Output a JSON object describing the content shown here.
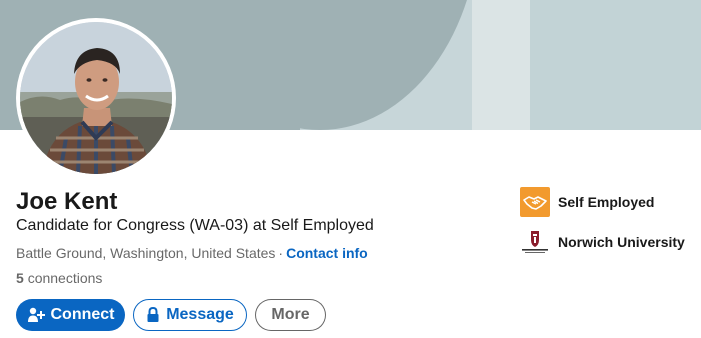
{
  "profile": {
    "name": "Joe Kent",
    "headline": "Candidate for Congress (WA-03) at Self Employed",
    "location": "Battle Ground, Washington, United States",
    "separator": "·",
    "contact_info": "Contact info",
    "connections_count": "5",
    "connections_label": "connections"
  },
  "actions": {
    "connect": "Connect",
    "message": "Message",
    "more": "More"
  },
  "sidebar": {
    "items": [
      {
        "label": "Self Employed",
        "icon": "handshake-icon"
      },
      {
        "label": "Norwich University",
        "icon": "norwich-university-logo"
      }
    ],
    "norwich_logo_text": "NORWICH UNIVERSITY"
  },
  "colors": {
    "brand_blue": "#0a66c2",
    "self_employed_orange": "#f29a2e",
    "banner": "#9fb1b4"
  }
}
